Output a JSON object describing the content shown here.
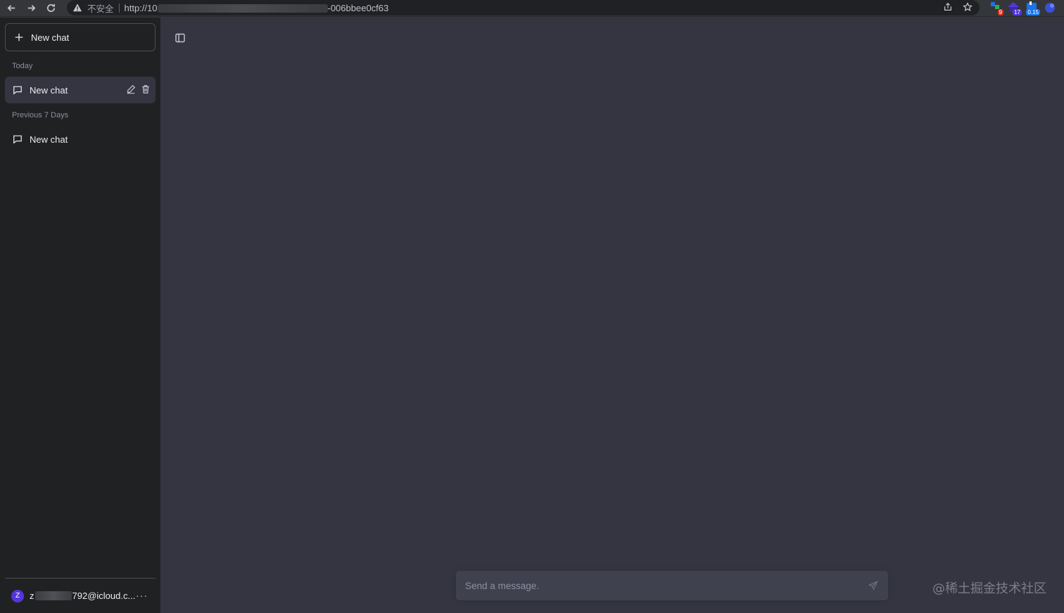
{
  "browser": {
    "security_label": "不安全",
    "url_prefix": "http://10",
    "url_suffix": "-006bbee0cf63",
    "extensions": [
      {
        "name": "extension-1",
        "badge": "9",
        "badge_color": "#d93025"
      },
      {
        "name": "extension-2",
        "badge": "17",
        "badge_color": "#5436da"
      },
      {
        "name": "extension-3",
        "badge": "0.15",
        "badge_color": "#1a73e8"
      },
      {
        "name": "extension-4",
        "badge": "",
        "badge_color": ""
      }
    ]
  },
  "sidebar": {
    "new_chat_label": "New chat",
    "groups": [
      {
        "label": "Today",
        "items": [
          {
            "label": "New chat",
            "active": true
          }
        ]
      },
      {
        "label": "Previous 7 Days",
        "items": [
          {
            "label": "New chat",
            "active": false
          }
        ]
      }
    ],
    "user": {
      "avatar_letter": "Z",
      "email_start": "z",
      "email_end": "792@icloud.c...",
      "more_label": "···"
    }
  },
  "main": {
    "composer_placeholder": "Send a message."
  },
  "watermark": "@稀土掘金技术社区",
  "colors": {
    "sidebar_bg": "#202123",
    "main_bg": "#343541",
    "composer_bg": "#40414f",
    "avatar_bg": "#5436da"
  }
}
